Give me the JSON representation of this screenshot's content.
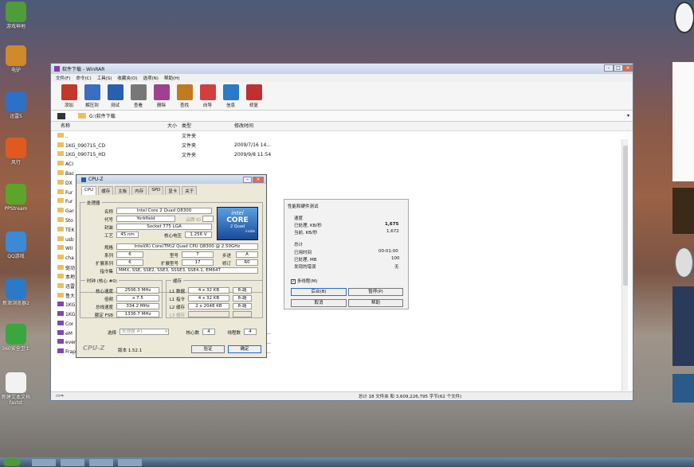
{
  "desktop": {
    "icons": [
      {
        "label": "游戏神地",
        "color": "#4e9c3a"
      },
      {
        "label": "电驴",
        "color": "#d08a2a"
      },
      {
        "label": "迅雷5",
        "color": "#2e6fc8"
      },
      {
        "label": "风行",
        "color": "#e05a20"
      },
      {
        "label": "PPStream",
        "color": "#5aa52a"
      },
      {
        "label": "QQ游戏",
        "color": "#3a8ad6"
      },
      {
        "label": "新浪浏览器2",
        "color": "#2a7ac8"
      },
      {
        "label": "360安全卫士",
        "color": "#3aa640"
      },
      {
        "label": "新建文本文档\nfastst",
        "color": "#f2f2f2"
      }
    ]
  },
  "winrar": {
    "title": "软件下载 - WinRAR",
    "menu": [
      "文件(F)",
      "命令(C)",
      "工具(S)",
      "收藏夹(O)",
      "选项(N)",
      "帮助(H)"
    ],
    "toolbar": [
      {
        "label": "添加",
        "color": "#c0392b"
      },
      {
        "label": "解压到",
        "color": "#3a6ec0"
      },
      {
        "label": "测试",
        "color": "#2a5fb0"
      },
      {
        "label": "查看",
        "color": "#777777"
      },
      {
        "label": "删除",
        "color": "#a04090"
      },
      {
        "label": "查找",
        "color": "#c07a20"
      },
      {
        "label": "向导",
        "color": "#d04040"
      },
      {
        "label": "信息",
        "color": "#2a7ac8"
      },
      {
        "label": "修复",
        "color": "#c03030"
      }
    ],
    "address": "G:\\软件下载",
    "columns": [
      "名称",
      "大小",
      "类型",
      "修改时间"
    ],
    "files": [
      {
        "name": "..",
        "size": "",
        "type": "文件夹",
        "date": "",
        "folder": true
      },
      {
        "name": "1KG_090715_CD",
        "size": "",
        "type": "文件夹",
        "date": "2009/7/16 14...",
        "folder": true
      },
      {
        "name": "1KG_090715_HD",
        "size": "",
        "type": "文件夹",
        "date": "2009/9/8 11:54",
        "folder": true
      },
      {
        "name": "ACI",
        "size": "",
        "type": "",
        "date": "",
        "folder": true
      },
      {
        "name": "Bac",
        "size": "",
        "type": "",
        "date": "",
        "folder": true
      },
      {
        "name": "DX",
        "size": "",
        "type": "",
        "date": "",
        "folder": true
      },
      {
        "name": "Fur",
        "size": "",
        "type": "",
        "date": "",
        "folder": true
      },
      {
        "name": "Fur",
        "size": "",
        "type": "",
        "date": "",
        "folder": true
      },
      {
        "name": "Gar",
        "size": "",
        "type": "",
        "date": "",
        "folder": true
      },
      {
        "name": "Sto",
        "size": "",
        "type": "",
        "date": "",
        "folder": true
      },
      {
        "name": "TEK",
        "size": "",
        "type": "",
        "date": "",
        "folder": true
      },
      {
        "name": "usb",
        "size": "",
        "type": "",
        "date": "",
        "folder": true
      },
      {
        "name": "WII",
        "size": "",
        "type": "",
        "date": "",
        "folder": true
      },
      {
        "name": "cha",
        "size": "",
        "type": "",
        "date": "",
        "folder": true
      },
      {
        "name": "驱动",
        "size": "",
        "type": "",
        "date": "",
        "folder": true
      },
      {
        "name": "本地",
        "size": "",
        "type": "",
        "date": "",
        "folder": true
      },
      {
        "name": "迅雷",
        "size": "",
        "type": "",
        "date": "",
        "folder": true
      },
      {
        "name": "鲁大",
        "size": "",
        "type": "",
        "date": "",
        "folder": true
      },
      {
        "name": "1KG",
        "size": "",
        "type": "",
        "date": "",
        "folder": false
      },
      {
        "name": "1KG",
        "size": "",
        "type": "",
        "date": "",
        "folder": false
      },
      {
        "name": "Cor",
        "size": "",
        "type": "",
        "date": "",
        "folder": false
      },
      {
        "name": "eM",
        "size": "2,973,669",
        "type": "WinRAR 压缩文...",
        "date": "2009/8/31 12...",
        "folder": false
      },
      {
        "name": "everestultimat...",
        "size": "10,553,754",
        "type": "WinRAR ZIP 压缩...",
        "date": "2009/11/24 0...",
        "folder": false
      },
      {
        "name": "Fraps.rar",
        "size": "2,384,209",
        "type": "WinRAR 压缩文件",
        "date": "2009/11/24 1...",
        "folder": false
      }
    ],
    "status_left": "▭⇒",
    "status": "总计 18 文件夹 和 3,609,226,795 字节(62 个文件)"
  },
  "cpuz": {
    "title": "CPU-Z",
    "tabs": [
      "CPU",
      "缓存",
      "主板",
      "内存",
      "SPD",
      "显卡",
      "关于"
    ],
    "processor_group": "处理器",
    "name_label": "名称",
    "name_value": "Intel Core 2 Quad Q8300",
    "code_label": "代号",
    "code_value": "Yorkfield",
    "brand_label": "品牌 ID",
    "package_label": "封装",
    "package_value": "Socket 775 LGA",
    "tech_label": "工艺",
    "tech_value": "45 nm",
    "voltage_label": "核心电压",
    "voltage_value": "1.256 V",
    "spec_label": "规格",
    "spec_value": "Intel(R) Core(TM)2 Quad CPU    Q8300  @ 2.50GHz",
    "family_label": "系列",
    "family_value": "6",
    "model_label": "型号",
    "model_value": "7",
    "stepping_label": "步进",
    "stepping_value": "A",
    "extfam_label": "扩展系列",
    "extfam_value": "6",
    "extmodel_label": "扩展型号",
    "extmodel_value": "17",
    "revision_label": "修订",
    "revision_value": "R0",
    "inst_label": "指令集",
    "inst_value": "MMX, SSE, SSE2, SSE3, SSSE3, SSE4.1, EM64T",
    "logo_brand": "intel",
    "logo_core": "CORE",
    "logo_sub": "2 Quad",
    "logo_inside": "inside",
    "clock_group": "时钟 (核心 #0)",
    "core_speed_label": "核心速度",
    "core_speed_value": "2506.3 MHz",
    "mult_label": "倍频",
    "mult_value": "x 7.5",
    "bus_label": "总线速度",
    "bus_value": "334.2 MHz",
    "fsb_label": "额定 FSB",
    "fsb_value": "1336.7 MHz",
    "cache_group": "缓存",
    "l1d_label": "L1 数据",
    "l1d_value": "4 x 32 KB",
    "l1d_way": "8-路",
    "l1i_label": "L1 指令",
    "l1i_value": "4 x 32 KB",
    "l1i_way": "8-路",
    "l2_label": "L2 缓存",
    "l2_value": "2 x 2048 KB",
    "l2_way": "8-路",
    "l3_label": "L3 缓存",
    "select_label": "选择",
    "select_value": "处理器 #1",
    "cores_label": "核心数",
    "cores_value": "4",
    "threads_label": "线程数",
    "threads_value": "4",
    "brand_footer": "CPU-Z",
    "version": "版本 1.52.1",
    "validate": "验证",
    "ok": "确定"
  },
  "perf": {
    "title": "性能和硬件测试",
    "speed_head": "速度",
    "processed_label": "已处理, KB/秒",
    "processed_value": "1,675",
    "current_label": "当前, KB/秒",
    "current_value": "1,672",
    "total_head": "总计",
    "elapsed_label": "已用时间",
    "elapsed_value": "00:01:00",
    "processed_mb_label": "已处理, MB",
    "processed_mb_value": "100",
    "errors_label": "发现的错误",
    "errors_value": "无",
    "multithread": "多线程(M)",
    "background": "后台(B)",
    "pause": "暂停(P)",
    "cancel": "取消",
    "help": "帮助"
  }
}
